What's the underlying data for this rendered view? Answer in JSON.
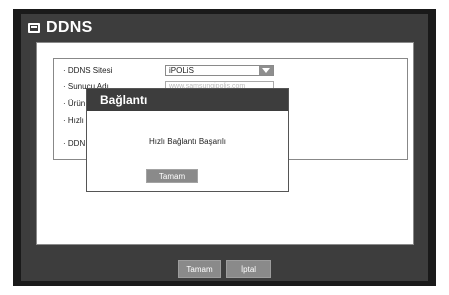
{
  "window": {
    "title": "DDNS"
  },
  "settings": {
    "rows": [
      {
        "label": "· DDNS Sitesi"
      },
      {
        "label": "· Sunucu Adı"
      },
      {
        "label": "· Ürün"
      },
      {
        "label": "· Hızlı"
      },
      {
        "label": "· DDN"
      }
    ],
    "site_select": {
      "value": "iPOLiS"
    },
    "server_field": {
      "placeholder": "www.samsungipolis.com"
    }
  },
  "footer": {
    "ok_label": "Tamam",
    "cancel_label": "İptal"
  },
  "dialog": {
    "title": "Bağlantı",
    "message": "Hızlı Bağlantı Başarılı",
    "ok_label": "Tamam"
  },
  "colors": {
    "window_bg": "#3d3d3d",
    "frame_bg": "#1a1a1a",
    "button_bg": "#8a8a8a",
    "content_bg": "#ffffff"
  }
}
